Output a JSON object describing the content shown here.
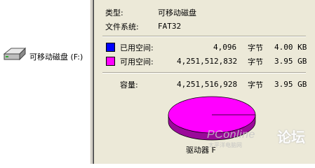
{
  "left": {
    "drive_label": "可移动磁盘 (F:)",
    "drive_icon": "removable-drive-icon"
  },
  "general": {
    "type_label": "类型:",
    "type_value": "可移动磁盘",
    "fs_label": "文件系统:",
    "fs_value": "FAT32"
  },
  "usage": {
    "used_label": "已用空间:",
    "used_bytes": "4,096",
    "used_unit": "字节",
    "used_size": "4.00 KB",
    "used_color": "#0000ff",
    "free_label": "可用空间:",
    "free_bytes": "4,251,512,832",
    "free_unit": "字节",
    "free_size": "3.95 GB",
    "free_color": "#ff00ff",
    "capacity_label": "容量:",
    "capacity_bytes": "4,251,516,928",
    "capacity_unit": "字节",
    "capacity_size": "3.95 GB",
    "used_fraction": 1e-06
  },
  "drive_caption": "驱动器 F",
  "watermark": {
    "site": "PConline",
    "sub": "太平洋电脑网",
    "forum": "论坛"
  }
}
